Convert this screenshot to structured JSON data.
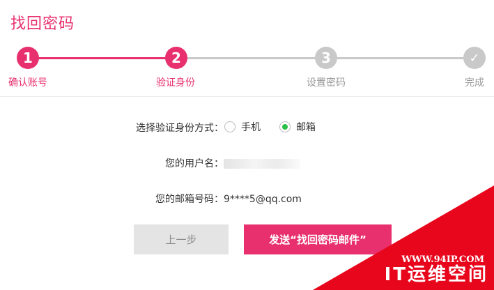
{
  "page": {
    "title": "找回密码"
  },
  "steps": [
    {
      "number": "1",
      "label": "确认账号",
      "state": "done"
    },
    {
      "number": "2",
      "label": "验证身份",
      "state": "current"
    },
    {
      "number": "3",
      "label": "设置密码",
      "state": "pending"
    },
    {
      "number": "✓",
      "label": "完成",
      "state": "pending"
    }
  ],
  "form": {
    "method_label": "选择验证身份方式：",
    "method_options": [
      {
        "label": "手机",
        "checked": false
      },
      {
        "label": "邮箱",
        "checked": true
      }
    ],
    "username_label": "您的用户名：",
    "email_label": "您的邮箱号码：",
    "email_value": "9****5@qq.com"
  },
  "buttons": {
    "prev_label": "上一步",
    "send_label": "发送“找回密码邮件”"
  },
  "watermark": {
    "url": "WWW.94IP.COM",
    "name": "IT运维空间"
  },
  "colors": {
    "accent": "#e8306e",
    "inactive": "#c9c9c9",
    "radio_checked": "#2bbf48",
    "watermark": "#e8061c"
  }
}
